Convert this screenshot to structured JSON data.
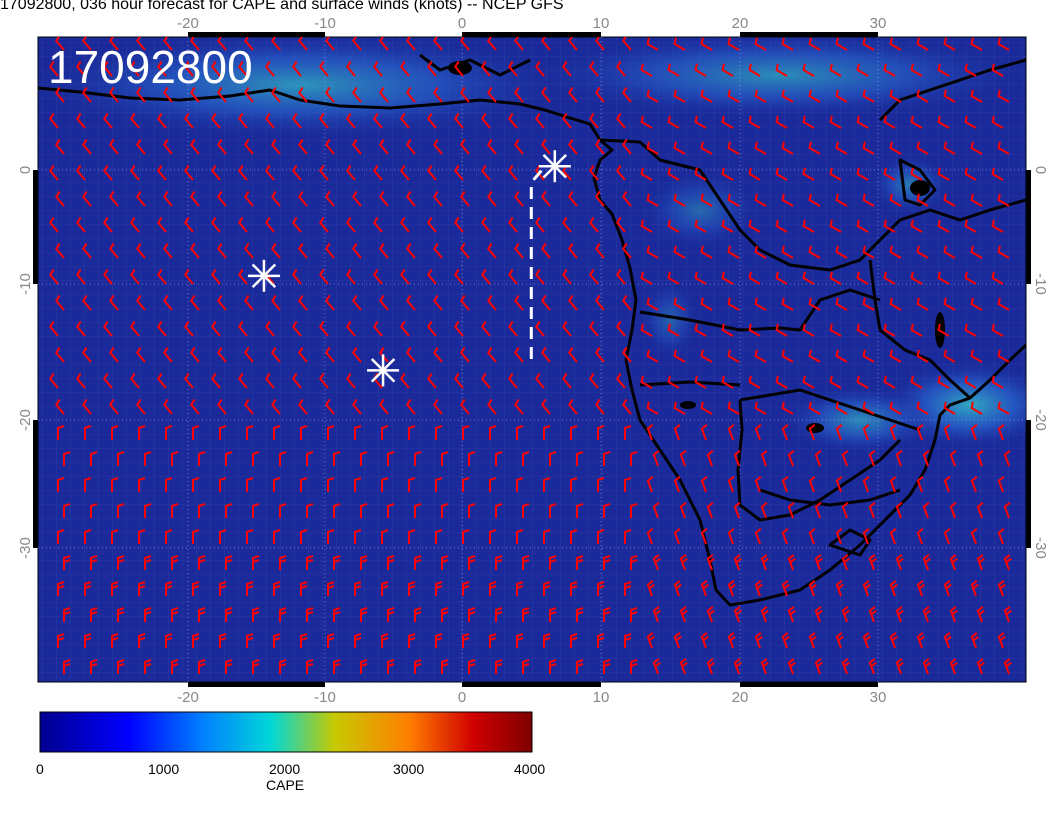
{
  "title": "17092800, 036 hour forecast for CAPE and surface winds (knots) -- NCEP GFS",
  "map": {
    "stamp": "17092800",
    "lon_ticks": [
      "-20",
      "-10",
      "0",
      "10",
      "20",
      "30"
    ],
    "lat_ticks": [
      "0",
      "-10",
      "-20",
      "-30"
    ],
    "land_outline_color": "#000000",
    "ocean_color": "#1a2a9a",
    "wind_barb_color": "#ff0000",
    "marker_color": "#ffffff",
    "markers": [
      {
        "name": "asterisk-marker",
        "lon": 6.7,
        "lat": 0.3
      },
      {
        "name": "asterisk-marker",
        "lon": -14.3,
        "lat": -8.4
      },
      {
        "name": "asterisk-marker",
        "lon": -5.7,
        "lat": -15.9
      }
    ],
    "track": {
      "lon": [
        5.0,
        5.0,
        6.0
      ],
      "lat": [
        -15,
        -1,
        0.3
      ],
      "style": "dashed",
      "color": "#ffffff"
    }
  },
  "colorbar": {
    "label": "CAPE",
    "ticks": [
      "0",
      "1000",
      "2000",
      "3000",
      "4000"
    ],
    "range": [
      0,
      4000
    ],
    "colors": [
      "#00008f",
      "#0000ff",
      "#007fff",
      "#00ffff",
      "#c8c800",
      "#ff7f00",
      "#d00000",
      "#7f0000"
    ]
  }
}
